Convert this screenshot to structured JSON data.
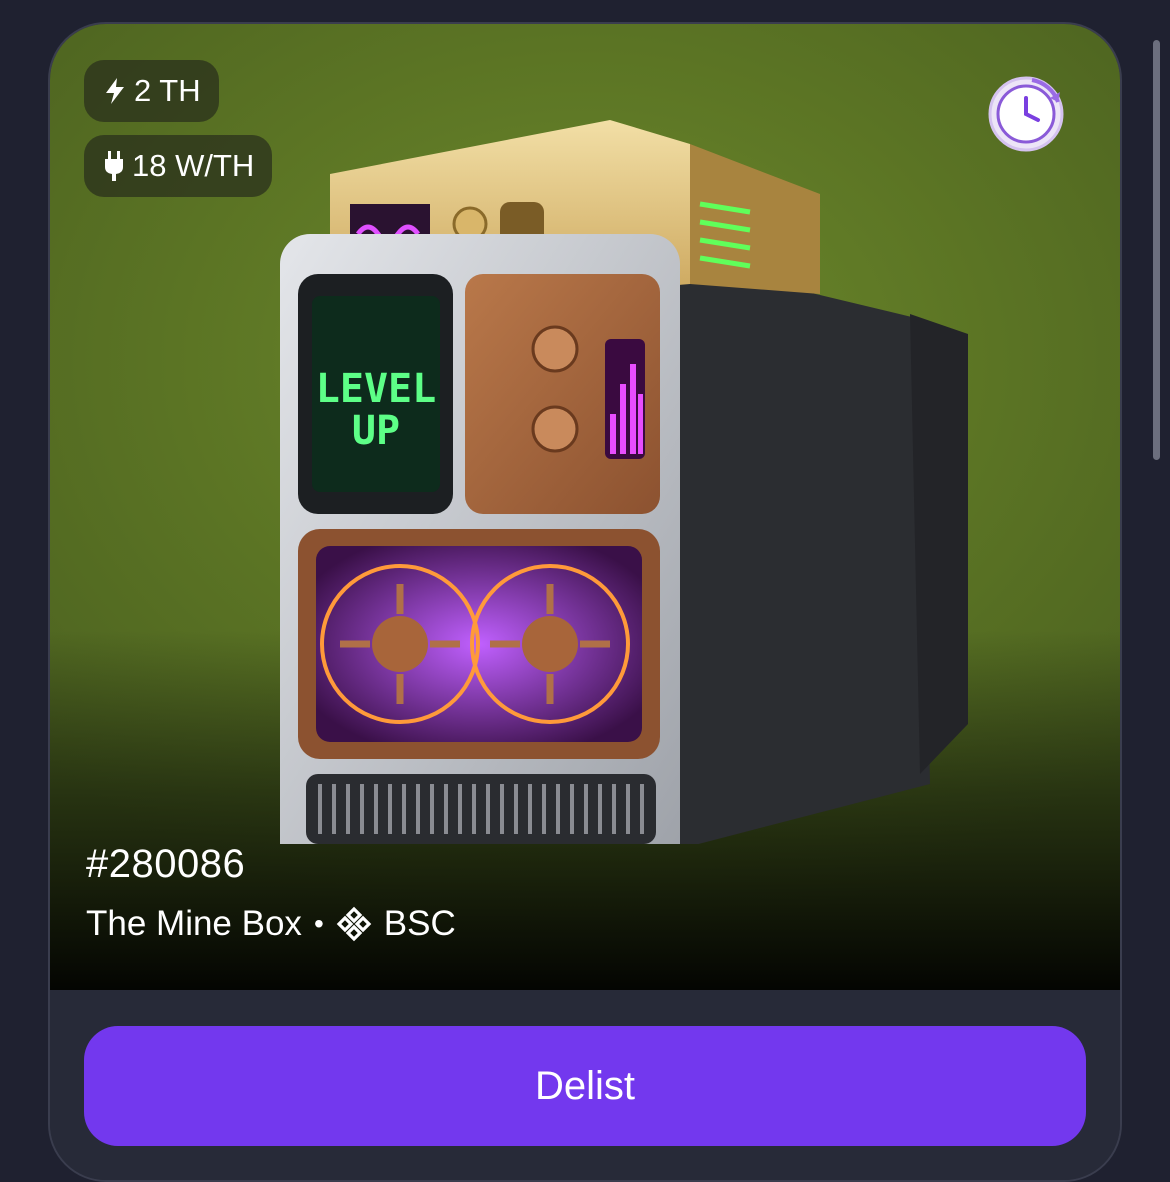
{
  "nft": {
    "hashrate": "2 TH",
    "efficiency": "18 W/TH",
    "token_id": "#280086",
    "collection": "The Mine Box",
    "separator": "•",
    "chain": "BSC",
    "screen_text_line1": "LEVEL",
    "screen_text_line2": "UP"
  },
  "icons": {
    "hashrate": "lightning-icon",
    "efficiency": "plug-icon",
    "chain": "bnb-chain-icon",
    "timer": "clock-timer-icon"
  },
  "actions": {
    "delist_label": "Delist"
  },
  "colors": {
    "page_bg": "#1f2130",
    "card_bg": "#272a38",
    "image_bg": "#5b7424",
    "button": "#7338ee",
    "text": "#ffffff"
  }
}
